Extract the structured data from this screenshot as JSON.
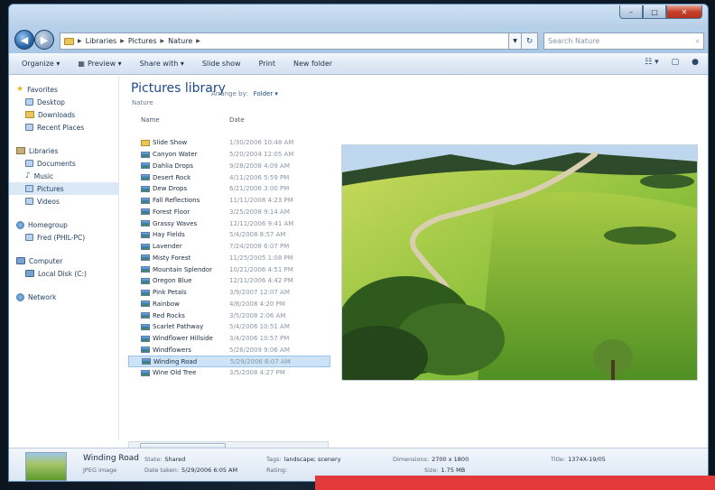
{
  "window": {
    "caption_min": "–",
    "caption_max": "□",
    "caption_close": "✕"
  },
  "address": {
    "crumbs": [
      "Libraries",
      "Pictures",
      "Nature"
    ],
    "search_placeholder": "Search Nature"
  },
  "toolbar": {
    "organize": "Organize ▾",
    "preview": "Preview ▾",
    "share": "Share with ▾",
    "slideshow": "Slide show",
    "print": "Print",
    "new_folder": "New folder"
  },
  "nav": {
    "favorites": "Favorites",
    "desktop": "Desktop",
    "downloads": "Downloads",
    "recent": "Recent Places",
    "libraries": "Libraries",
    "documents": "Documents",
    "music": "Music",
    "pictures": "Pictures",
    "videos": "Videos",
    "homegroup": "Homegroup",
    "homegroup_user": "Fred (PHIL-PC)",
    "computer": "Computer",
    "local_disk": "Local Disk (C:)",
    "network": "Network"
  },
  "list": {
    "title": "Pictures library",
    "subtitle": "Nature",
    "arrange_label": "Arrange by:",
    "arrange_value": "Folder ▾",
    "col_name": "Name",
    "col_date": "Date",
    "files": [
      {
        "name": "Slide Show",
        "date": "1/30/2006 10:48 AM",
        "folder": true
      },
      {
        "name": "Canyon Water",
        "date": "5/20/2004 12:05 AM"
      },
      {
        "name": "Dahlia Drops",
        "date": "9/28/2008 4:09 AM"
      },
      {
        "name": "Desert Rock",
        "date": "4/11/2006 5:59 PM"
      },
      {
        "name": "Dew Drops",
        "date": "6/21/2006 3:00 PM"
      },
      {
        "name": "Fall Reflections",
        "date": "11/11/2008 4:23 PM"
      },
      {
        "name": "Forest Floor",
        "date": "3/25/2008 9:14 AM"
      },
      {
        "name": "Grassy Waves",
        "date": "12/11/2006 9:41 AM"
      },
      {
        "name": "Hay Fields",
        "date": "5/4/2008 8:57 AM"
      },
      {
        "name": "Lavender",
        "date": "7/24/2008 6:07 PM"
      },
      {
        "name": "Misty Forest",
        "date": "11/25/2005 1:08 PM"
      },
      {
        "name": "Mountain Splendor",
        "date": "10/21/2006 4:51 PM"
      },
      {
        "name": "Oregon Blue",
        "date": "12/11/2006 4:42 PM"
      },
      {
        "name": "Pink Petals",
        "date": "3/9/2007 12:07 AM"
      },
      {
        "name": "Rainbow",
        "date": "4/8/2008 4:20 PM"
      },
      {
        "name": "Red Rocks",
        "date": "3/5/2008 2:06 AM"
      },
      {
        "name": "Scarlet Pathway",
        "date": "5/4/2006 10:51 AM"
      },
      {
        "name": "Windflower Hillside",
        "date": "3/4/2006 10:57 PM"
      },
      {
        "name": "Windflowers",
        "date": "5/26/2009 9:06 AM"
      },
      {
        "name": "Winding Road",
        "date": "5/29/2006 6:07 AM",
        "selected": true
      },
      {
        "name": "Wine Old Tree",
        "date": "3/5/2008 4:27 PM"
      }
    ]
  },
  "details": {
    "name": "Winding Road",
    "type": "JPEG image",
    "state_label": "State:",
    "state_value": "Shared",
    "date_label": "Date taken:",
    "date_value": "5/29/2006 6:05 AM",
    "tags_label": "Tags:",
    "tags_value": "landscape; scenery",
    "rating_label": "Rating:",
    "dim_label": "Dimensions:",
    "dim_value": "2700 x 1800",
    "size_label": "Size:",
    "size_value": "1.75 MB",
    "title_label": "Title:",
    "title_value": "1374X-19/05"
  }
}
